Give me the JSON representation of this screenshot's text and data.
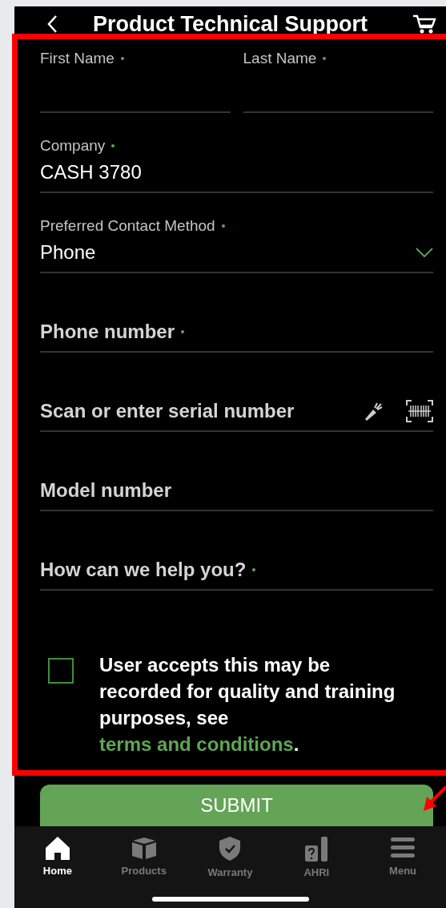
{
  "header": {
    "title": "Product Technical Support"
  },
  "name_fields": [
    {
      "label": "First Name",
      "required": true
    },
    {
      "label": "Last Name",
      "required": true
    }
  ],
  "fields": [
    {
      "kind": "labeled",
      "label": "Company",
      "required": true,
      "value": "CASH 3780"
    },
    {
      "kind": "select",
      "label": "Preferred Contact Method",
      "required": true,
      "value": "Phone"
    },
    {
      "kind": "input",
      "placeholder": "Phone number",
      "required": true
    },
    {
      "kind": "scan",
      "placeholder": "Scan or enter serial number",
      "required": false
    },
    {
      "kind": "input",
      "placeholder": "Model number",
      "required": false
    },
    {
      "kind": "input",
      "placeholder": "How can we help you?",
      "required": true
    }
  ],
  "consent": {
    "checked": false,
    "text": "User accepts this may be recorded for quality and training purposes, see ",
    "link": "terms and conditions",
    "end": "."
  },
  "submit": "SUBMIT",
  "tabs": [
    {
      "label": "Home",
      "kind": "home",
      "selected": true
    },
    {
      "label": "Products",
      "kind": "box",
      "selected": false
    },
    {
      "label": "Warranty",
      "kind": "shield",
      "selected": false
    },
    {
      "label": "AHRI",
      "kind": "ahri",
      "selected": false
    },
    {
      "label": "Menu",
      "kind": "menu",
      "selected": false
    }
  ]
}
